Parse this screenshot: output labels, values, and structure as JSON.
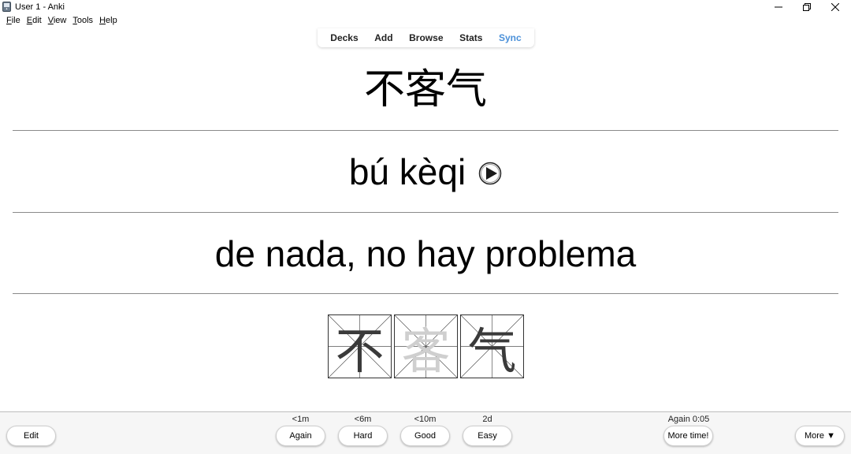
{
  "window": {
    "title": "User 1 - Anki"
  },
  "menu": [
    {
      "label": "File",
      "acc": "F",
      "rest": "ile"
    },
    {
      "label": "Edit",
      "acc": "E",
      "rest": "dit"
    },
    {
      "label": "View",
      "acc": "V",
      "rest": "iew"
    },
    {
      "label": "Tools",
      "acc": "T",
      "rest": "ools"
    },
    {
      "label": "Help",
      "acc": "H",
      "rest": "elp"
    }
  ],
  "nav": {
    "decks": "Decks",
    "add": "Add",
    "browse": "Browse",
    "stats": "Stats",
    "sync": "Sync"
  },
  "colors": {
    "sync_accent": "#4a90d9",
    "divider": "#8a8a8a"
  },
  "card": {
    "hanzi": "不客气",
    "pinyin": "bú kèqi",
    "meaning": "de nada, no hay problema",
    "stroke_chars": [
      "不",
      "客",
      "气"
    ],
    "play_icon": "play-audio-icon"
  },
  "answer": {
    "again": {
      "label": "Again",
      "interval": "<1m"
    },
    "hard": {
      "label": "Hard",
      "interval": "<6m"
    },
    "good": {
      "label": "Good",
      "interval": "<10m"
    },
    "easy": {
      "label": "Easy",
      "interval": "2d"
    }
  },
  "edit_label": "Edit",
  "timer": "Again 0:05",
  "more_time_label": "More time!",
  "more_label": "More ▼"
}
